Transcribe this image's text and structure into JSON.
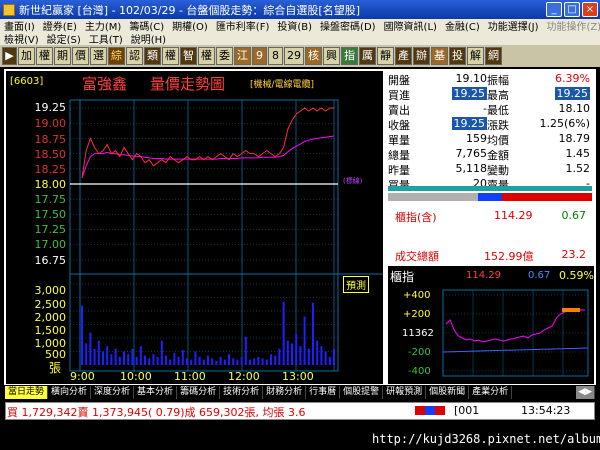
{
  "window": {
    "title": "新世紀贏家 [台灣] - 102/03/29 - 台盤個股走勢：綜合自選股[名望股]",
    "btn_min": "_",
    "btn_max": "□",
    "btn_close": "×"
  },
  "menu1": [
    "畫面(I)",
    "證券(E)",
    "主力(M)",
    "籌碼(C)",
    "期權(O)",
    "匯市利率(F)",
    "投資(B)",
    "操盤密碼(D)",
    "國際資訊(L)",
    "金融(C)",
    "功能選擇(J)",
    "功能操作(Z)"
  ],
  "menu2": [
    "檢視(V)",
    "設定(S)",
    "工具(T)",
    "說明(H)"
  ],
  "toolbar": [
    "加",
    "權",
    "期",
    "價",
    "選",
    "綜",
    "認",
    "類",
    "權",
    "智",
    "權",
    "委",
    "江",
    "9",
    "8",
    "29",
    "核",
    "興",
    "指",
    "厲",
    "靜",
    "產",
    "辦",
    "基",
    "投",
    "解",
    "網"
  ],
  "chart": {
    "code": "[6603]",
    "name": "富強鑫",
    "title": "量價走勢圖",
    "mode": "[機械/電線電纜]",
    "price_ticks": [
      "19.25",
      "19.00",
      "18.75",
      "18.50",
      "18.25",
      "18.00",
      "17.75",
      "17.50",
      "17.25",
      "17.00",
      "16.75"
    ],
    "volume_ticks": [
      "3,000",
      "2,500",
      "2,000",
      "1,500",
      "1,000",
      "500"
    ],
    "volume_unit": "張",
    "time_ticks": [
      "9:00",
      "10:00",
      "11:00",
      "12:00",
      "13:00"
    ],
    "forecast_label": "預測",
    "reference_label": "(標線)",
    "prev_close": 18.0,
    "price_series": [
      18.1,
      18.55,
      18.75,
      18.6,
      18.5,
      18.55,
      18.65,
      18.5,
      18.55,
      18.45,
      18.6,
      18.5,
      18.4,
      18.5,
      18.45,
      18.35,
      18.4,
      18.3,
      18.35,
      18.4,
      18.35,
      18.45,
      18.4,
      18.35,
      18.4,
      18.45,
      18.4,
      18.4,
      18.45,
      18.4,
      18.45,
      18.4,
      18.45,
      18.5,
      18.45,
      18.4,
      18.5,
      18.45,
      18.5,
      18.55,
      18.5,
      18.5,
      18.45,
      18.5,
      18.55,
      18.5,
      18.45,
      18.5,
      18.6,
      18.9,
      19.05,
      19.15,
      19.2,
      19.25,
      19.2,
      19.25,
      19.2,
      19.25,
      19.2,
      19.25,
      19.25
    ],
    "avg_series": [
      18.1,
      18.3,
      18.45,
      18.5,
      18.5,
      18.5,
      18.52,
      18.5,
      18.5,
      18.48,
      18.48,
      18.47,
      18.46,
      18.45,
      18.45,
      18.44,
      18.43,
      18.42,
      18.42,
      18.42,
      18.41,
      18.41,
      18.41,
      18.41,
      18.41,
      18.41,
      18.41,
      18.41,
      18.41,
      18.41,
      18.41,
      18.41,
      18.41,
      18.42,
      18.42,
      18.42,
      18.42,
      18.42,
      18.43,
      18.43,
      18.43,
      18.43,
      18.43,
      18.44,
      18.44,
      18.44,
      18.44,
      18.45,
      18.47,
      18.53,
      18.58,
      18.62,
      18.66,
      18.7,
      18.72,
      18.74,
      18.75,
      18.76,
      18.77,
      18.78,
      18.79
    ],
    "volume_series": [
      2200,
      800,
      1200,
      600,
      900,
      500,
      700,
      400,
      600,
      300,
      500,
      400,
      600,
      300,
      700,
      350,
      250,
      400,
      300,
      900,
      350,
      200,
      450,
      300,
      550,
      250,
      200,
      500,
      300,
      200,
      350,
      250,
      150,
      300,
      200,
      400,
      250,
      200,
      300,
      1050,
      200,
      250,
      300,
      250,
      200,
      400,
      350,
      600,
      2350,
      900,
      800,
      1150,
      700,
      1800,
      600,
      2300,
      900,
      700,
      500,
      300,
      600
    ]
  },
  "quote": {
    "open_l": "開盤",
    "open_v": "19.10",
    "amp_l": "振幅",
    "amp_v": "6.39%",
    "bid_l": "買進",
    "bid_v": "19.25",
    "high_l": "最高",
    "high_v": "19.25",
    "ask_l": "賣出",
    "ask_v": "-",
    "low_l": "最低",
    "low_v": "18.10",
    "close_l": "收盤",
    "close_v": "19.25",
    "chg_l": "漲跌",
    "chg_v": "1.25(6%)",
    "vol1_l": "單量",
    "vol1_v": "159",
    "avg_l": "均價",
    "avg_v": "18.79",
    "tvol_l": "總量",
    "tvol_v": "7,765",
    "amt_l": "金額",
    "amt_v": "1.45",
    "yvol_l": "昨量",
    "yvol_v": "5,118",
    "turn_l": "變動",
    "turn_v": "1.52",
    "bq_l": "買量",
    "bq_v": "20",
    "sq_l": "賣量",
    "sq_v": "-"
  },
  "index_panel": {
    "label1": "櫃指(含)",
    "val1": "114.29",
    "chg1": "0.67",
    "label2": "成交總額",
    "val2": "152.99億",
    "chg2": "23.2"
  },
  "mini": {
    "label": "櫃指",
    "val": "114.29",
    "chg": "0.67",
    "pct": "0.59%",
    "ticks": [
      "+400",
      "+200",
      "11362",
      "-200",
      "-400"
    ]
  },
  "tabs": [
    "當日走勢",
    "橫向分析",
    "深度分析",
    "基本分析",
    "籌碼分析",
    "技術分析",
    "財務分析",
    "行事曆",
    "個股提警",
    "研報預測",
    "個股新聞",
    "產業分析"
  ],
  "status": {
    "trade": "買 1,729,342賣 1,373,945( 0.79)成 659,302張, 均張 3.6",
    "code": "[001",
    "time": "13:54:23"
  },
  "watermark": "http://kujd3268.pixnet.net/album",
  "colors": {
    "price_line": "#ff3030",
    "avg_line": "#ff00ff",
    "volume_bar": "#2020ff",
    "grid": "#0070a0"
  }
}
